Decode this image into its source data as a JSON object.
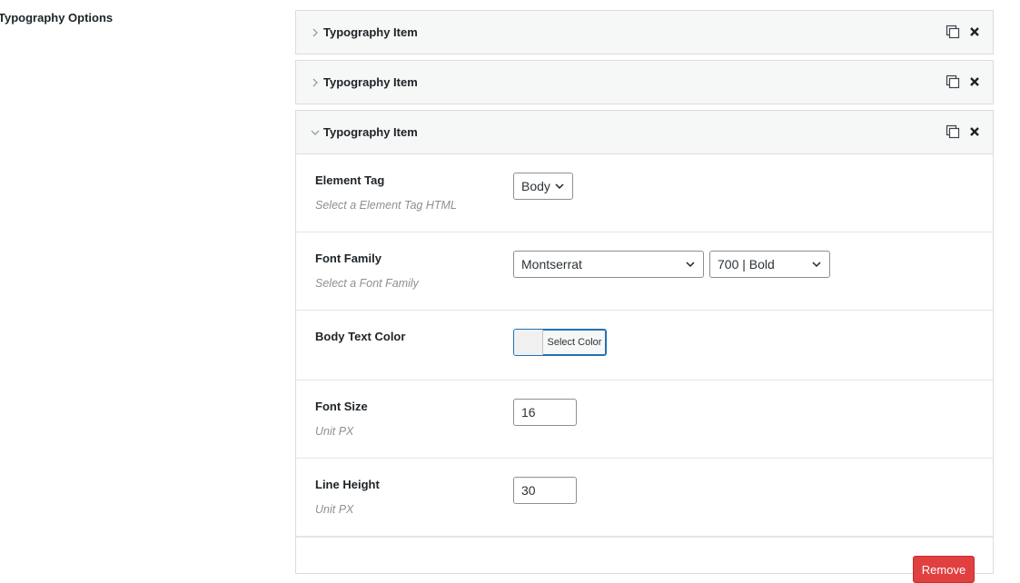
{
  "page": {
    "section_label": "Typography Options"
  },
  "items": [
    {
      "title": "Typography Item",
      "expanded": false
    },
    {
      "title": "Typography Item",
      "expanded": false
    },
    {
      "title": "Typography Item",
      "expanded": true
    }
  ],
  "fields": {
    "element_tag": {
      "label": "Element Tag",
      "desc": "Select a Element Tag HTML",
      "value": "Body"
    },
    "font_family": {
      "label": "Font Family",
      "desc": "Select a Font Family",
      "family": "Montserrat",
      "weight": "700 | Bold"
    },
    "body_text_color": {
      "label": "Body Text Color",
      "button": "Select Color"
    },
    "font_size": {
      "label": "Font Size",
      "desc": "Unit PX",
      "value": "16"
    },
    "line_height": {
      "label": "Line Height",
      "desc": "Unit PX",
      "value": "30"
    }
  },
  "actions": {
    "remove": "Remove"
  },
  "colors": {
    "accent": "#2271b1",
    "danger": "#e04040"
  }
}
